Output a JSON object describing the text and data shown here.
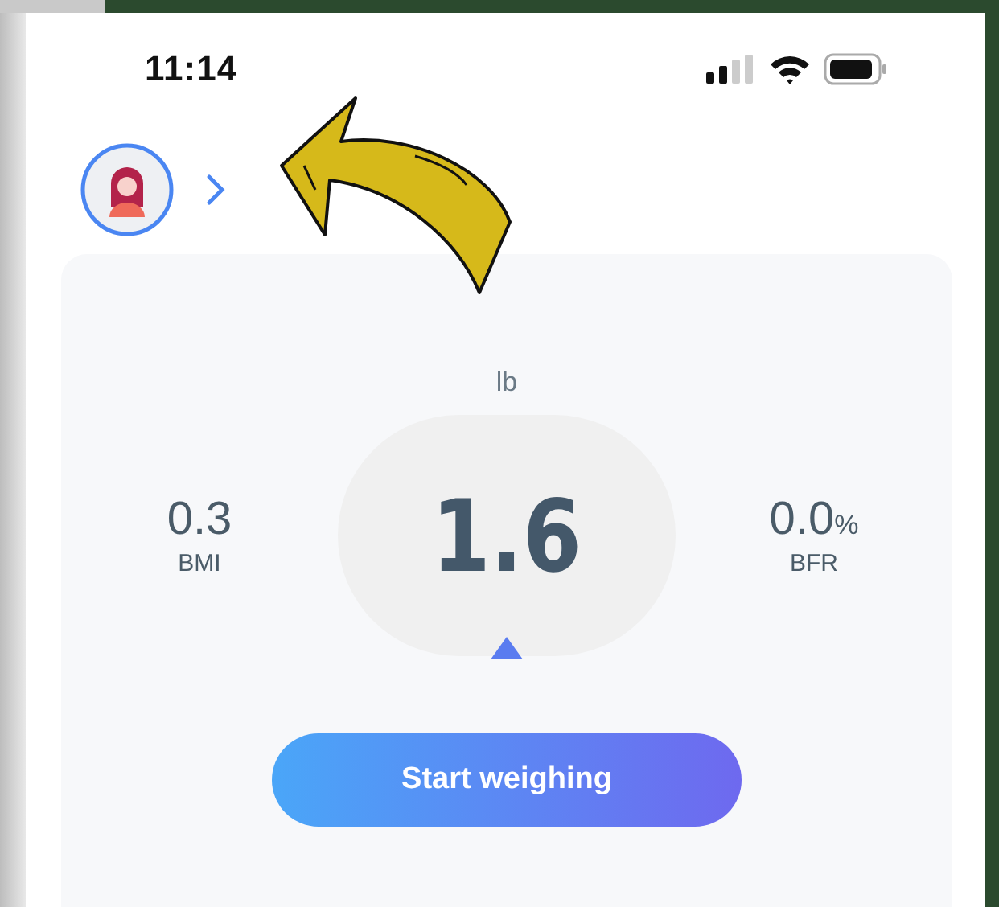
{
  "status_bar": {
    "time": "11:14"
  },
  "weight": {
    "unit": "lb",
    "value": "1.6"
  },
  "stats": [
    {
      "value": "0.3",
      "label": "BMI"
    },
    {
      "value": "0.0",
      "unit": "%",
      "label": "BFR"
    }
  ],
  "button": {
    "label": "Start weighing"
  }
}
